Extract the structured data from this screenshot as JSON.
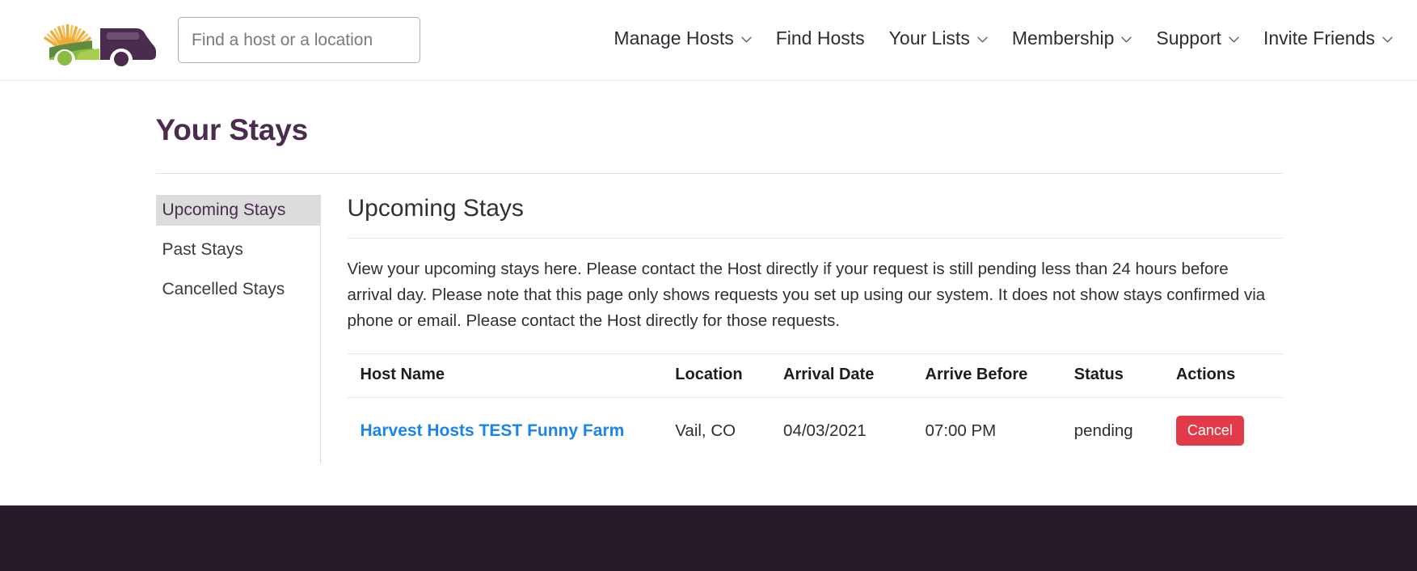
{
  "header": {
    "logo_name": "harvest-hosts-logo",
    "search": {
      "placeholder": "Find a host or a location",
      "value": ""
    },
    "nav": [
      {
        "label": "Manage Hosts",
        "has_chevron": true
      },
      {
        "label": "Find Hosts",
        "has_chevron": false
      },
      {
        "label": "Your Lists",
        "has_chevron": true
      },
      {
        "label": "Membership",
        "has_chevron": true
      },
      {
        "label": "Support",
        "has_chevron": true
      },
      {
        "label": "Invite Friends",
        "has_chevron": true
      }
    ]
  },
  "page": {
    "title": "Your Stays"
  },
  "sidebar": {
    "items": [
      {
        "label": "Upcoming Stays",
        "active": true
      },
      {
        "label": "Past Stays",
        "active": false
      },
      {
        "label": "Cancelled Stays",
        "active": false
      }
    ]
  },
  "main": {
    "heading": "Upcoming Stays",
    "intro": "View your upcoming stays here. Please contact the Host directly if your request is still pending less than 24 hours before arrival day. Please note that this page only shows requests you set up using our system. It does not show stays confirmed via phone or email. Please contact the Host directly for those requests.",
    "table": {
      "headers": [
        "Host Name",
        "Location",
        "Arrival Date",
        "Arrive Before",
        "Status",
        "Actions"
      ],
      "rows": [
        {
          "host_name": "Harvest Hosts TEST Funny Farm",
          "location": "Vail, CO",
          "arrival_date": "04/03/2021",
          "arrive_before": "07:00 PM",
          "status": "pending",
          "action_label": "Cancel"
        }
      ]
    }
  },
  "colors": {
    "brand_purple": "#4b2c4e",
    "link_blue": "#1a85e8",
    "danger_red": "#e23a48",
    "footer_dark": "#261c28",
    "active_tab_bg": "#dcdcdc",
    "logo_sun": "#f5a623",
    "logo_field_dark": "#5c8a3c",
    "logo_field_light": "#9cc742"
  }
}
